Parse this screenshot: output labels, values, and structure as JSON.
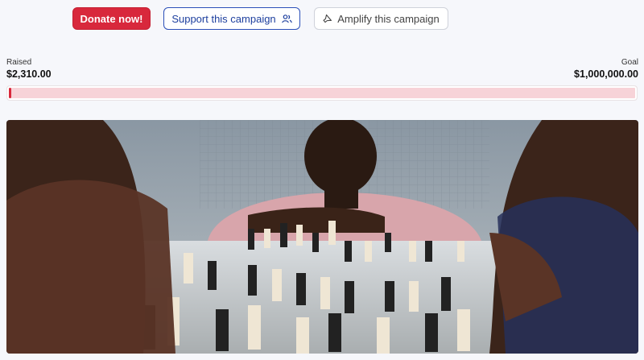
{
  "actions": {
    "donate_label": "Donate now!",
    "support_label": "Support this campaign",
    "amplify_label": "Amplify this campaign"
  },
  "icons": {
    "support": "people-icon",
    "amplify": "megaphone-icon"
  },
  "funding": {
    "raised_label": "Raised",
    "raised_value": "$2,310.00",
    "goal_label": "Goal",
    "goal_value": "$1,000,000.00",
    "progress_fraction": 0.00231
  },
  "colors": {
    "accent": "#d8283c",
    "support_text": "#1d3f9e",
    "progress_track": "#f7d3d8"
  },
  "media": {
    "image_subject": "campaign-photo"
  }
}
